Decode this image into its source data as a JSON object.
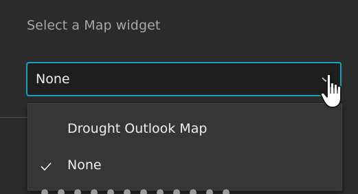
{
  "map_widget": {
    "label": "Select a Map widget",
    "selected_value": "None",
    "options": [
      {
        "label": "Drought Outlook Map",
        "selected": false
      },
      {
        "label": "None",
        "selected": true
      }
    ]
  },
  "icons": {
    "chevron": "chevron-down-icon",
    "check": "check-icon",
    "cursor": "hand-pointer-cursor"
  },
  "colors": {
    "background": "#2b2b2b",
    "accent_border": "#1a9fbf",
    "dropdown_bg": "#363636",
    "text": "#eeeeee",
    "label_text": "#a8a8a8"
  }
}
